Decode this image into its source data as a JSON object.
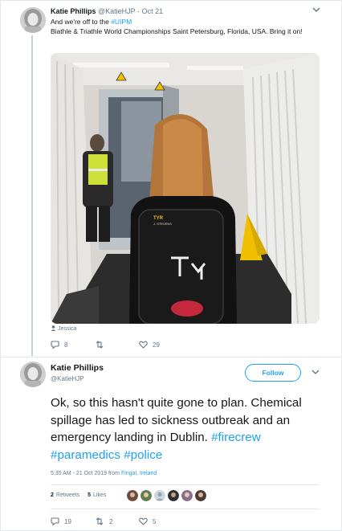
{
  "tweet1": {
    "name": "Katie Phillips",
    "handle": "@KatieHJP",
    "separator": "·",
    "date": "Oct 21",
    "text_plain": "And we're off to the ",
    "hashtag": "#UIPM",
    "text_rest": "Biathle & Triathle World Championships Saint Petersburg, Florida, USA. Bring it on!",
    "tagged_person": "Jessica",
    "replies": "8",
    "retweets": "",
    "likes": "29"
  },
  "tweet2": {
    "name": "Katie Phillips",
    "handle": "@KatieHJP",
    "follow_label": "Follow",
    "body_plain": "Ok, so this hasn't quite gone to plan. Chemical spillage has led to sickness outbreak and an emergency landing in Dublin. ",
    "hashtag1": "#firecrew",
    "hashtag2": "#paramedics",
    "hashtag3": "#police",
    "timestamp": "5:35 AM - 21 Oct 2019 from ",
    "location": "Fingal, Ireland",
    "retweets_count": "2",
    "retweets_label": "Retweets",
    "likes_count": "5",
    "likes_label": "Likes",
    "replies": "19",
    "retweets_action": "2",
    "likes_action": "5"
  },
  "colors": {
    "accent": "#1da1f2",
    "secondary_text": "#657786",
    "primary_text": "#14171a",
    "border": "#e1e8ed"
  },
  "icons": [
    "chevron-down-icon",
    "person-icon",
    "reply-icon",
    "retweet-icon",
    "heart-icon"
  ]
}
